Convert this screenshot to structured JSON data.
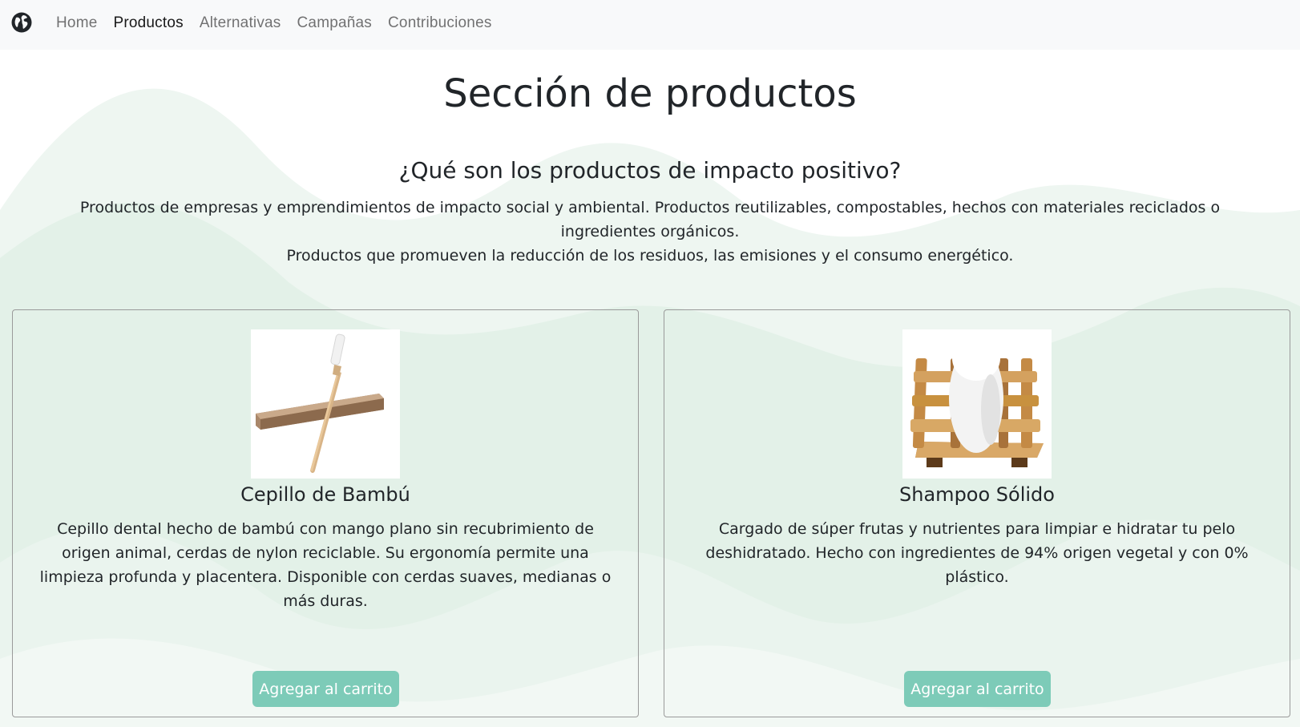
{
  "nav": {
    "brand_icon": "globe-icon",
    "items": [
      {
        "label": "Home",
        "active": false
      },
      {
        "label": "Productos",
        "active": true
      },
      {
        "label": "Alternativas",
        "active": false
      },
      {
        "label": "Campañas",
        "active": false
      },
      {
        "label": "Contribuciones",
        "active": false
      }
    ]
  },
  "page": {
    "title": "Sección de productos",
    "subtitle": "¿Qué son los productos de impacto positivo?",
    "intro_line1": "Productos de empresas y emprendimientos de impacto social y ambiental. Productos reutilizables, compostables, hechos con materiales reciclados o ingredientes orgánicos.",
    "intro_line2": "Productos que promueven la reducción de los residuos, las emisiones y el consumo energético."
  },
  "products": [
    {
      "name": "Cepillo de Bambú",
      "image": "bamboo-toothbrush-image",
      "description": "Cepillo dental hecho de bambú con mango plano sin recubrimiento de origen animal, cerdas de nylon reciclable. Su ergonomía permite una limpieza profunda y placentera. Disponible con cerdas suaves, medianas o más duras.",
      "button_label": "Agregar al carrito"
    },
    {
      "name": "Shampoo Sólido",
      "image": "solid-shampoo-image",
      "description": "Cargado de súper frutas y nutrientes para limpiar e hidratar tu pelo deshidratado. Hecho con ingredientes de 94% origen vegetal y con 0% plástico.",
      "button_label": "Agregar al carrito"
    }
  ],
  "colors": {
    "navbar_bg": "#f8f9fa",
    "button_bg": "#7dcbb8",
    "wave_light": "#eef6f1",
    "wave_dark": "#e0efe6"
  }
}
